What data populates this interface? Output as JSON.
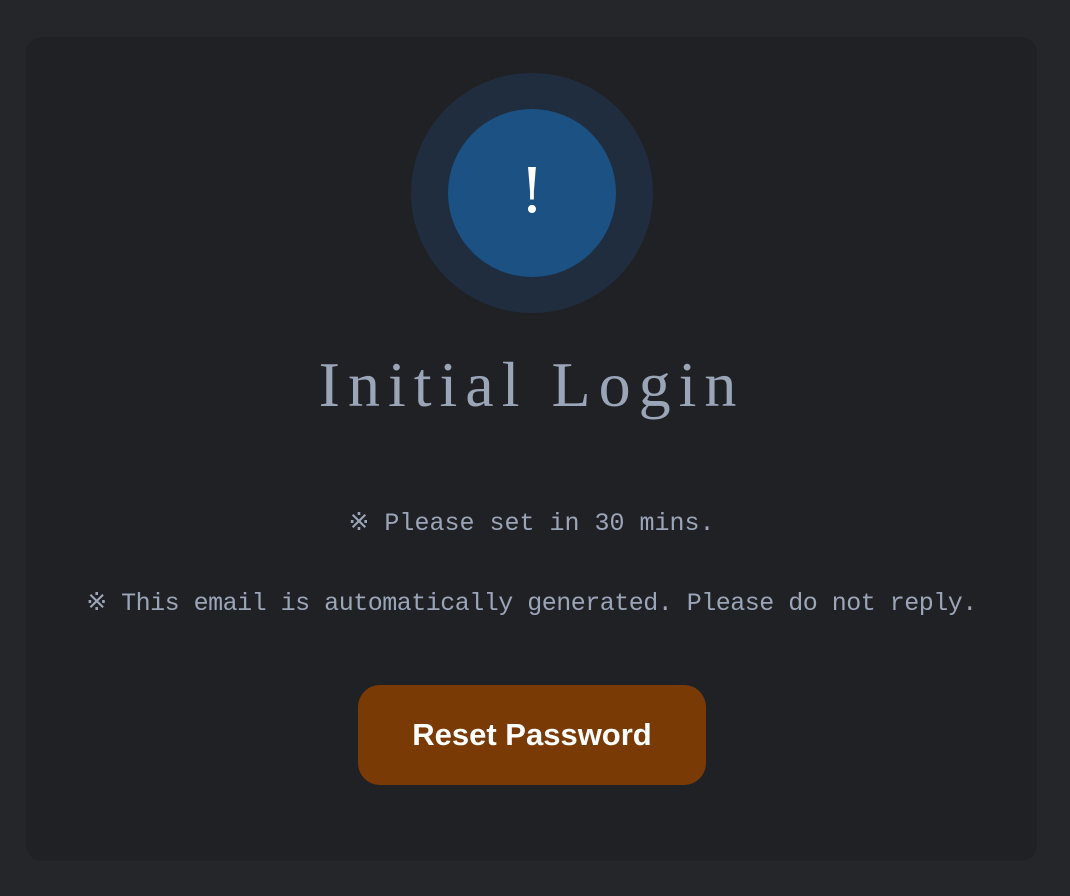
{
  "icon": {
    "name": "exclamation-icon",
    "glyph": "!"
  },
  "title": "Initial Login",
  "notes": [
    "※ Please set in 30 mins.",
    "※ This email is automatically generated. Please do not reply."
  ],
  "button": {
    "label": "Reset Password"
  },
  "colors": {
    "page_background": "#25262a",
    "card_background": "#202124",
    "icon_ring": "#1f2d3e",
    "icon_core": "#1c5183",
    "text": "#9aa5b8",
    "button": "#7a3a06",
    "button_text": "#ffffff"
  }
}
